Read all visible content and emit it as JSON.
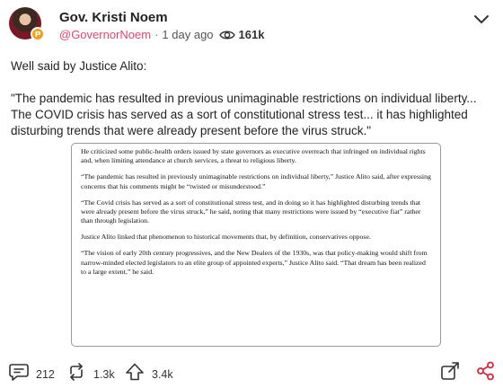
{
  "post": {
    "author_name": "Gov. Kristi Noem",
    "handle": "@GovernorNoem",
    "separator": "·",
    "time_ago": "1 day ago",
    "views": "161k",
    "text_line1": "Well said by Justice Alito:",
    "text_quote": "\"The pandemic has resulted in previous unimaginable restrictions on individual liberty... The COVID crisis has served as a sort of constitutional stress test... it has highlighted disturbing trends that were already present before the virus struck.\"",
    "quote_image": {
      "paragraphs": [
        "He criticized some public-health orders issued by state governors as executive overreach that infringed on individual rights and, when limiting attendance at church services, a threat to religious liberty.",
        "“The pandemic has resulted in previously unimaginable restrictions on individual liberty,” Justice Alito said, after expressing concerns that his comments might be “twisted or misunderstood.”",
        "“The Covid crisis has served as a sort of constitutional stress test, and in doing so it has highlighted disturbing trends that were already present before the virus struck,” he said, noting that many restrictions were issued by “executive fiat” rather than through legislation.",
        "Justice Alito linked that phenomenon to historical movements that, by definition, conservatives oppose.",
        "“The vision of early 20th century progressives, and the New Dealers of the 1930s, was that policy-making would shift from narrow-minded elected legislators to an elite group of appointed experts,” Justice Alito said. “That dream has been realized to a large extent,” he said."
      ]
    }
  },
  "actions": {
    "replies": "212",
    "reposts": "1.3k",
    "likes": "3.4k"
  },
  "icons": {
    "verified_badge": "badge-icon",
    "menu": "chevron-down-icon",
    "views": "eye-icon",
    "reply": "speech-bubble-icon",
    "repost": "repost-arrows-icon",
    "like": "upvote-arrow-icon",
    "expand": "expand-icon",
    "share": "share-icon"
  },
  "colors": {
    "handle": "#e0466d",
    "badge": "#f0a21b",
    "share_icon": "#d9263f"
  }
}
